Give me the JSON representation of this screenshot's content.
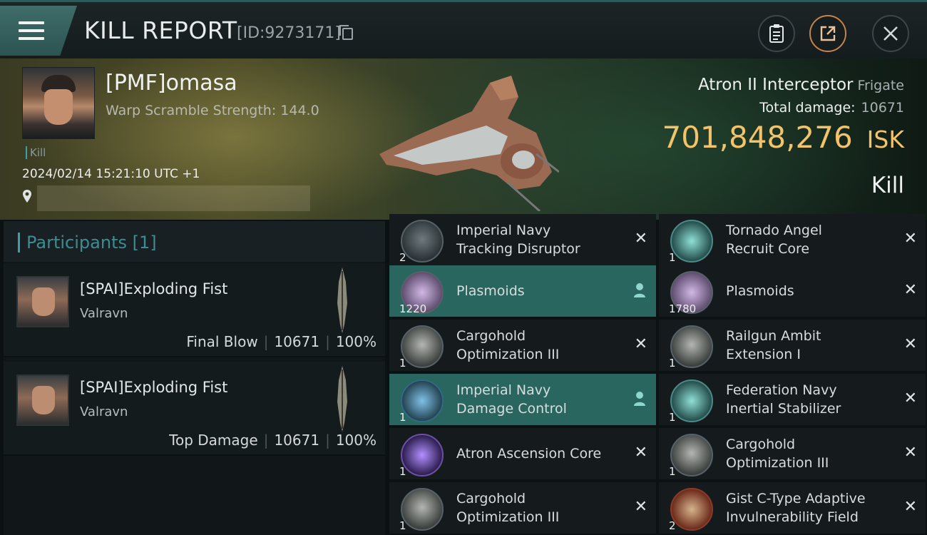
{
  "header": {
    "title": "KILL REPORT",
    "report_id": "[ID:9273171]"
  },
  "victim": {
    "name": "[PMF]omasa",
    "scramble": "Warp Scramble Strength: 144.0",
    "tag": "Kill",
    "datetime": "2024/02/14 15:21:10 UTC +1",
    "ship_name": "Atron II Interceptor",
    "ship_class": "Frigate",
    "total_damage_label": "Total damage:",
    "total_damage": "10671",
    "isk_value": "701,848,276",
    "isk_currency": "ISK",
    "result": "Kill"
  },
  "participants": {
    "label": "Participants [1]",
    "rows": [
      {
        "name": "[SPAI]Exploding Fist",
        "ship": "Valravn",
        "role": "Final Blow",
        "damage": "10671",
        "percent": "100%"
      },
      {
        "name": "[SPAI]Exploding Fist",
        "ship": "Valravn",
        "role": "Top Damage",
        "damage": "10671",
        "percent": "100%"
      }
    ]
  },
  "modules": [
    {
      "qty": "2",
      "line1": "Imperial Navy",
      "line2": "Tracking Disruptor",
      "status": "destroyed",
      "icon": "tracking-disruptor-icon"
    },
    {
      "qty": "1",
      "line1": "Tornado Angel",
      "line2": "Recruit Core",
      "status": "destroyed",
      "icon": "core-icon"
    },
    {
      "qty": "1220",
      "line1": "Plasmoids",
      "line2": "",
      "status": "dropped",
      "icon": "plasmoid-icon"
    },
    {
      "qty": "1780",
      "line1": "Plasmoids",
      "line2": "",
      "status": "destroyed",
      "icon": "plasmoid-icon"
    },
    {
      "qty": "1",
      "line1": "Cargohold",
      "line2": "Optimization III",
      "status": "destroyed",
      "icon": "cargohold-icon"
    },
    {
      "qty": "1",
      "line1": "Railgun Ambit",
      "line2": "Extension I",
      "status": "destroyed",
      "icon": "railgun-icon"
    },
    {
      "qty": "1",
      "line1": "Imperial Navy",
      "line2": "Damage Control",
      "status": "dropped",
      "icon": "damage-control-icon"
    },
    {
      "qty": "1",
      "line1": "Federation Navy",
      "line2": "Inertial Stabilizer",
      "status": "destroyed",
      "icon": "stabilizer-icon"
    },
    {
      "qty": "1",
      "line1": "Atron Ascension Core",
      "line2": "",
      "status": "destroyed",
      "icon": "core-icon"
    },
    {
      "qty": "1",
      "line1": "Cargohold",
      "line2": "Optimization III",
      "status": "destroyed",
      "icon": "cargohold-icon"
    },
    {
      "qty": "1",
      "line1": "Cargohold",
      "line2": "Optimization III",
      "status": "destroyed",
      "icon": "cargohold-icon"
    },
    {
      "qty": "2",
      "line1": "Gist C-Type Adaptive",
      "line2": "Invulnerability Field",
      "status": "destroyed",
      "icon": "shield-hardener-icon"
    }
  ],
  "colors": {
    "accent": "#3ca0a6",
    "isk": "#f2c36a",
    "dropped_highlight": "#2a6660"
  }
}
